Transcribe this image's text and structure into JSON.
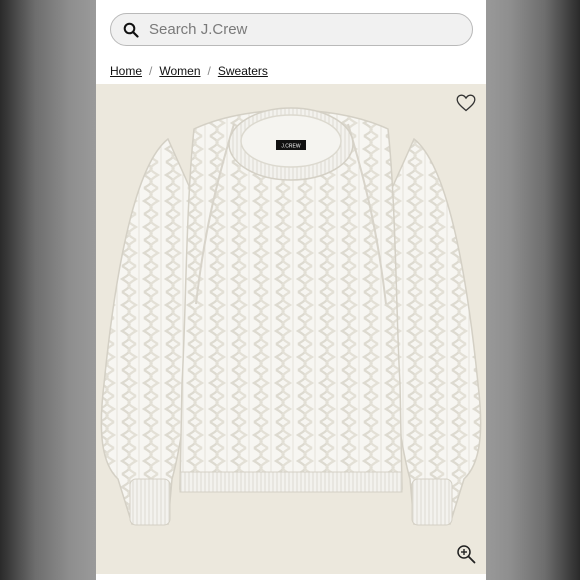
{
  "search": {
    "placeholder": "Search J.Crew",
    "icon": "search-icon"
  },
  "breadcrumb": {
    "items": [
      {
        "label": "Home"
      },
      {
        "label": "Women"
      },
      {
        "label": "Sweaters"
      }
    ],
    "separator": "/"
  },
  "product_image": {
    "label_text": "J.CREW",
    "wishlist_icon": "heart-icon",
    "zoom_icon": "zoom-in-icon"
  },
  "colors": {
    "background_tan": "#ece8dd",
    "sweater_white": "#f7f6f2",
    "text": "#111111"
  }
}
